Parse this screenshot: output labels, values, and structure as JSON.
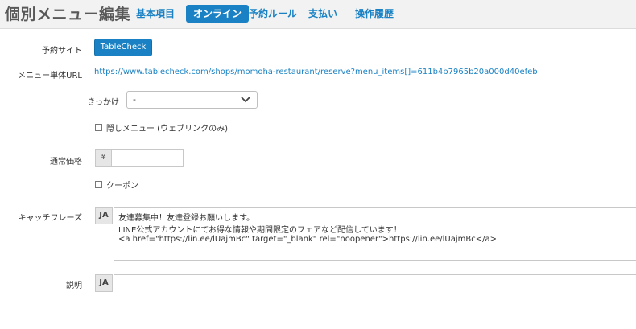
{
  "header": {
    "title": "個別メニュー編集",
    "tabs": [
      {
        "label": "基本項目",
        "active": false
      },
      {
        "label": "オンライン",
        "active": true
      },
      {
        "label": "予約ルール",
        "active": false
      },
      {
        "label": "支払い",
        "active": false
      },
      {
        "label": "操作履歴",
        "active": false
      }
    ]
  },
  "form": {
    "reservation_site": {
      "label": "予約サイト",
      "button": "TableCheck"
    },
    "menu_url": {
      "label": "メニュー単体URL",
      "url": "https://www.tablecheck.com/shops/momoha-restaurant/reserve?menu_items[]=611b4b7965b20a000d40efeb"
    },
    "trigger": {
      "label": "きっかけ",
      "value": "-"
    },
    "hidden_menu": {
      "label": "隠しメニュー (ウェブリンクのみ)",
      "checked": false
    },
    "regular_price": {
      "label": "通常価格",
      "currency": "¥",
      "value": ""
    },
    "coupon": {
      "label": "クーポン",
      "checked": false
    },
    "catchphrase": {
      "label": "キャッチフレーズ",
      "lang": "JA",
      "lines": [
        "友達募集中！友達登録お願いします。",
        "LINE公式アカウントにてお得な情報や期間限定のフェアなど配信しています！",
        "<a href=\"https://lin.ee/lUajmBc\" target=\"_blank\" rel=\"noopener\">https://lin.ee/lUajmBc</a>"
      ]
    },
    "description": {
      "label": "説明",
      "lang": "JA",
      "value": ""
    }
  },
  "colors": {
    "accent": "#1a82c4",
    "highlight_underline": "#e0322f"
  }
}
